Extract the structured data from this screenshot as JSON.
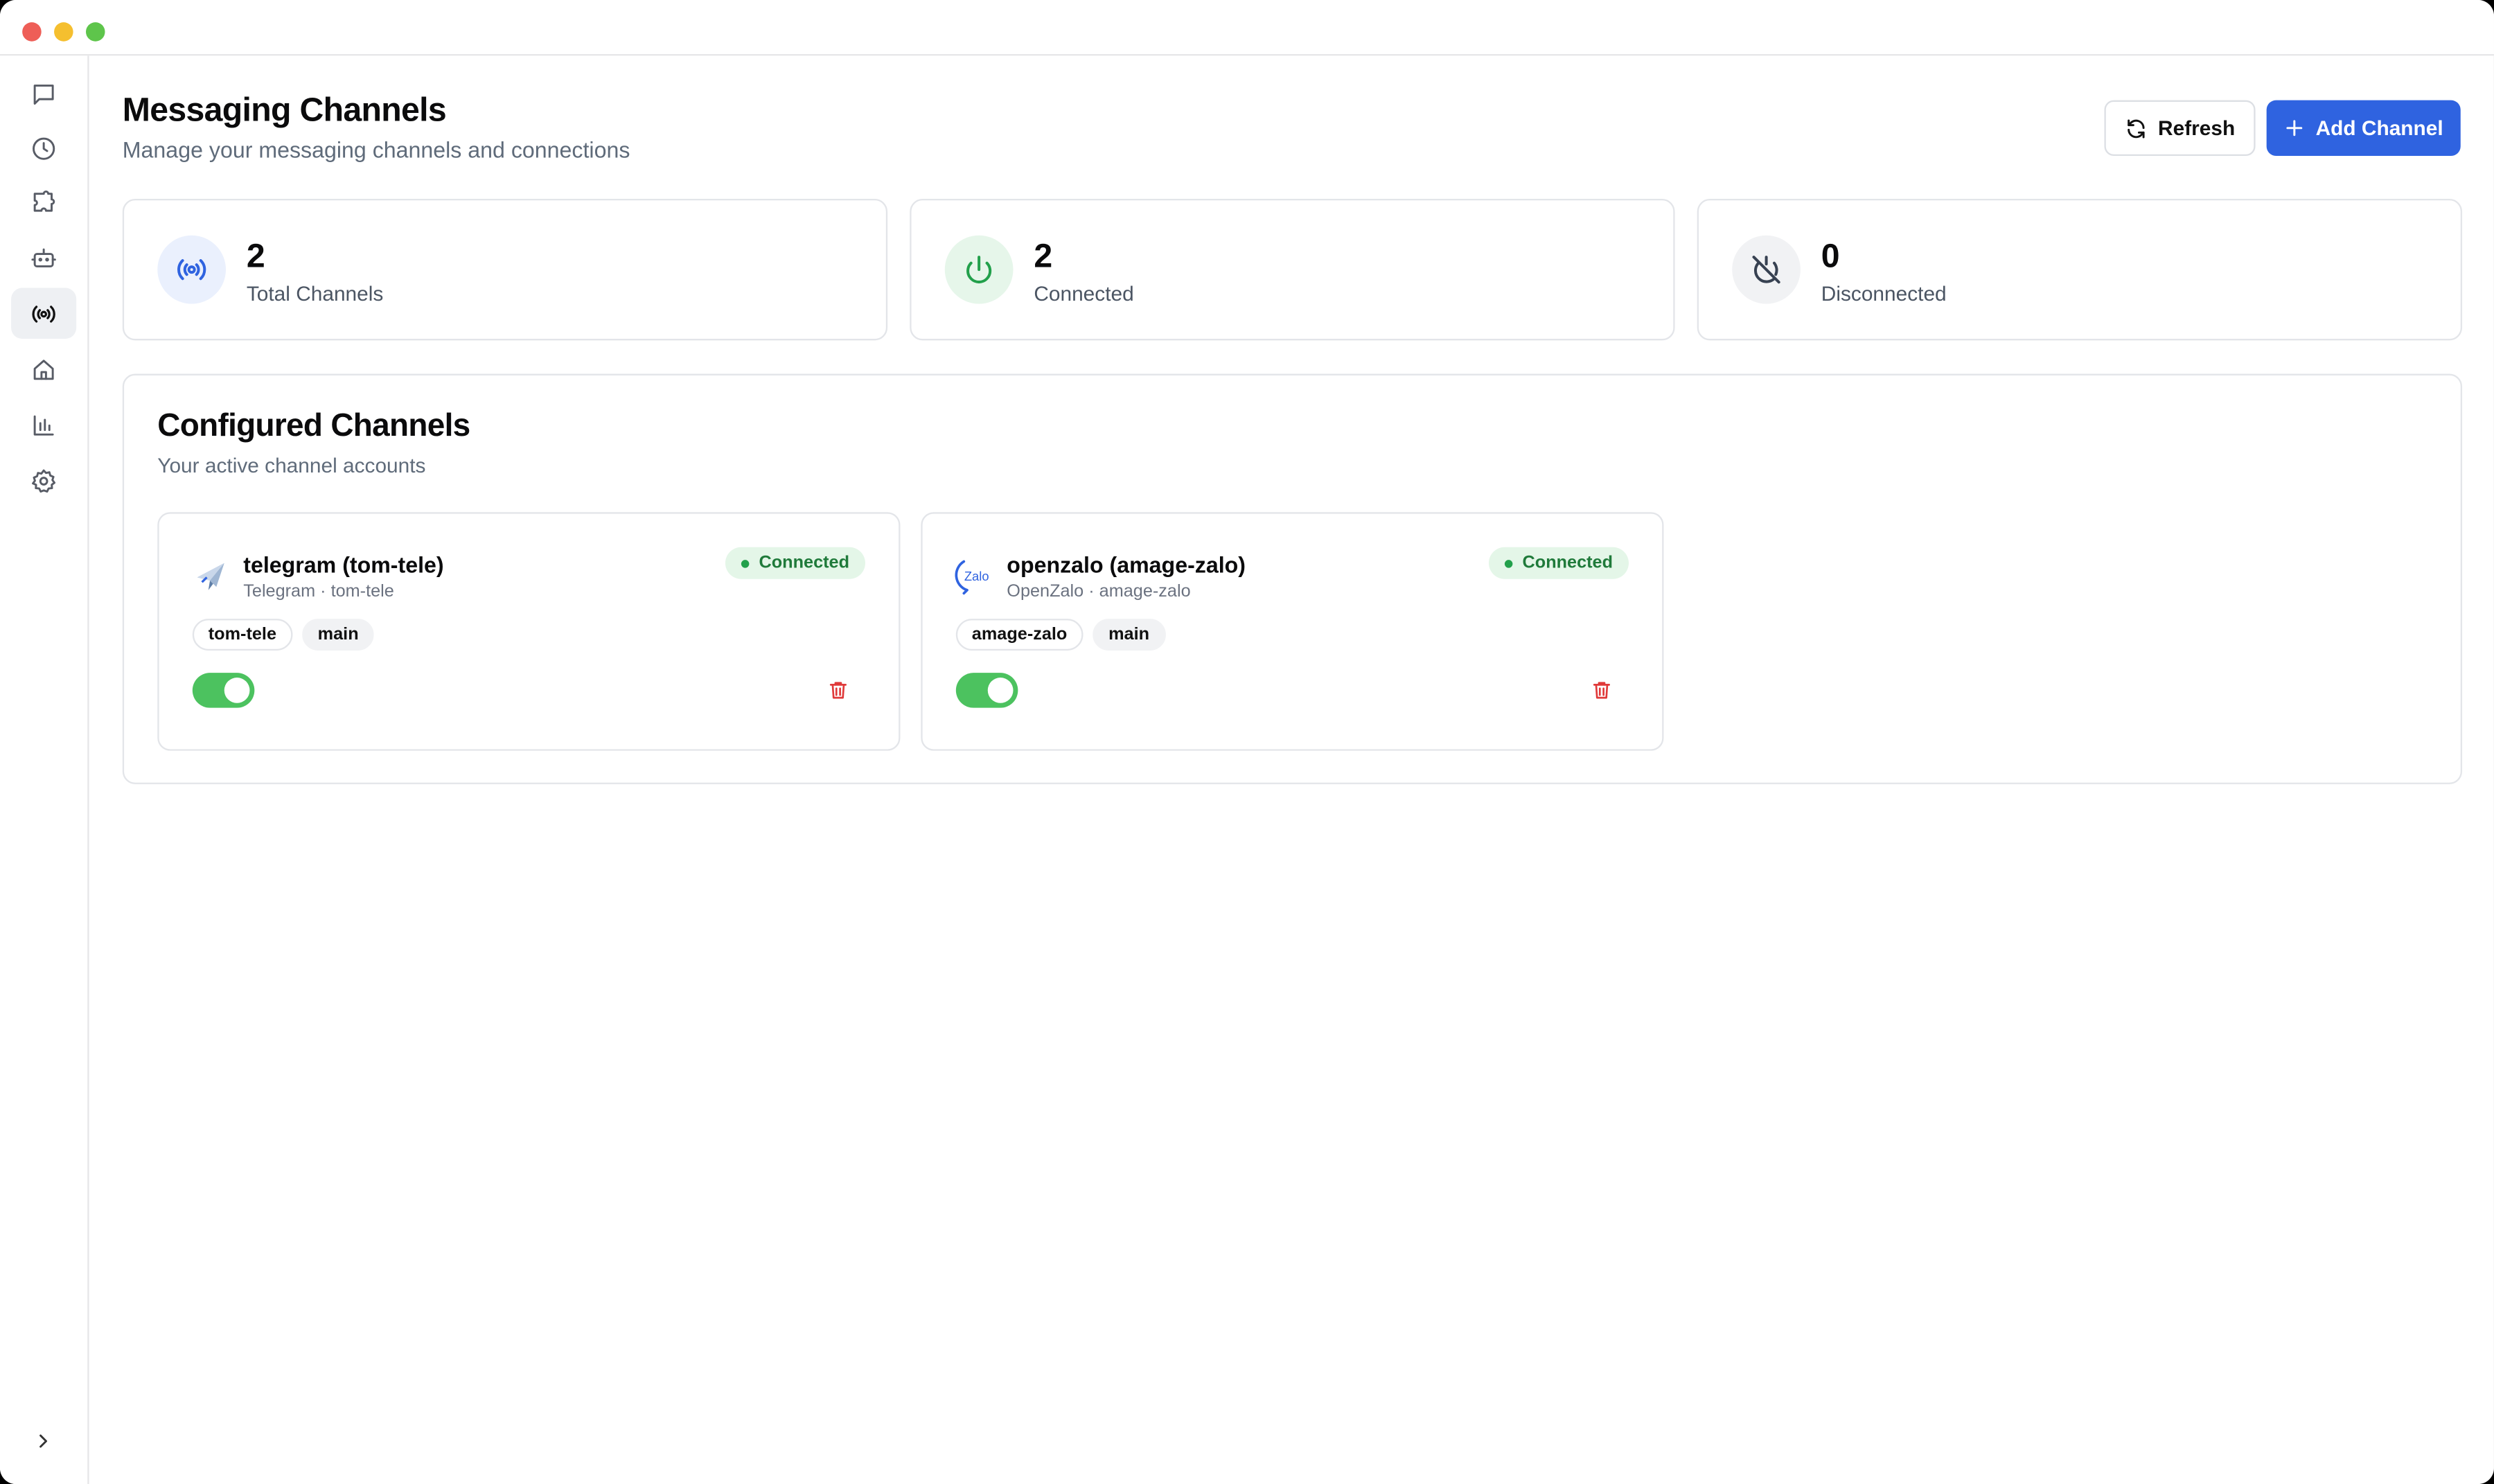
{
  "window": {
    "controls": [
      "close",
      "minimize",
      "maximize"
    ]
  },
  "sidebar": {
    "items": [
      {
        "icon": "chat-icon",
        "active": false
      },
      {
        "icon": "clock-icon",
        "active": false
      },
      {
        "icon": "puzzle-icon",
        "active": false
      },
      {
        "icon": "bot-icon",
        "active": false
      },
      {
        "icon": "radio-icon",
        "active": true
      },
      {
        "icon": "home-icon",
        "active": false
      },
      {
        "icon": "bar-chart-icon",
        "active": false
      },
      {
        "icon": "gear-icon",
        "active": false
      }
    ],
    "expand_icon": "chevron-right-icon"
  },
  "header": {
    "title": "Messaging Channels",
    "subtitle": "Manage your messaging channels and connections",
    "refresh_label": "Refresh",
    "add_label": "Add Channel"
  },
  "stats": [
    {
      "value": "2",
      "label": "Total Channels",
      "icon": "radio-icon",
      "color": "#2f63e0",
      "bg": "#eaf0fd"
    },
    {
      "value": "2",
      "label": "Connected",
      "icon": "power-icon",
      "color": "#22a04b",
      "bg": "#e6f6ea"
    },
    {
      "value": "0",
      "label": "Disconnected",
      "icon": "power-off-icon",
      "color": "#4b5563",
      "bg": "#f1f2f4"
    }
  ],
  "configured": {
    "title": "Configured Channels",
    "subtitle": "Your active channel accounts",
    "channels": [
      {
        "name": "telegram (tom-tele)",
        "meta": "Telegram · tom-tele",
        "status": "Connected",
        "tags": [
          "tom-tele",
          "main"
        ],
        "enabled": true,
        "logo": "telegram-plane-icon"
      },
      {
        "name": "openzalo (amage-zalo)",
        "meta": "OpenZalo · amage-zalo",
        "status": "Connected",
        "tags": [
          "amage-zalo",
          "main"
        ],
        "enabled": true,
        "logo": "zalo-logo-icon",
        "logo_text": "Zalo"
      }
    ]
  },
  "colors": {
    "accent": "#2f63e0",
    "success": "#4cc25f",
    "danger": "#e03a3a"
  }
}
